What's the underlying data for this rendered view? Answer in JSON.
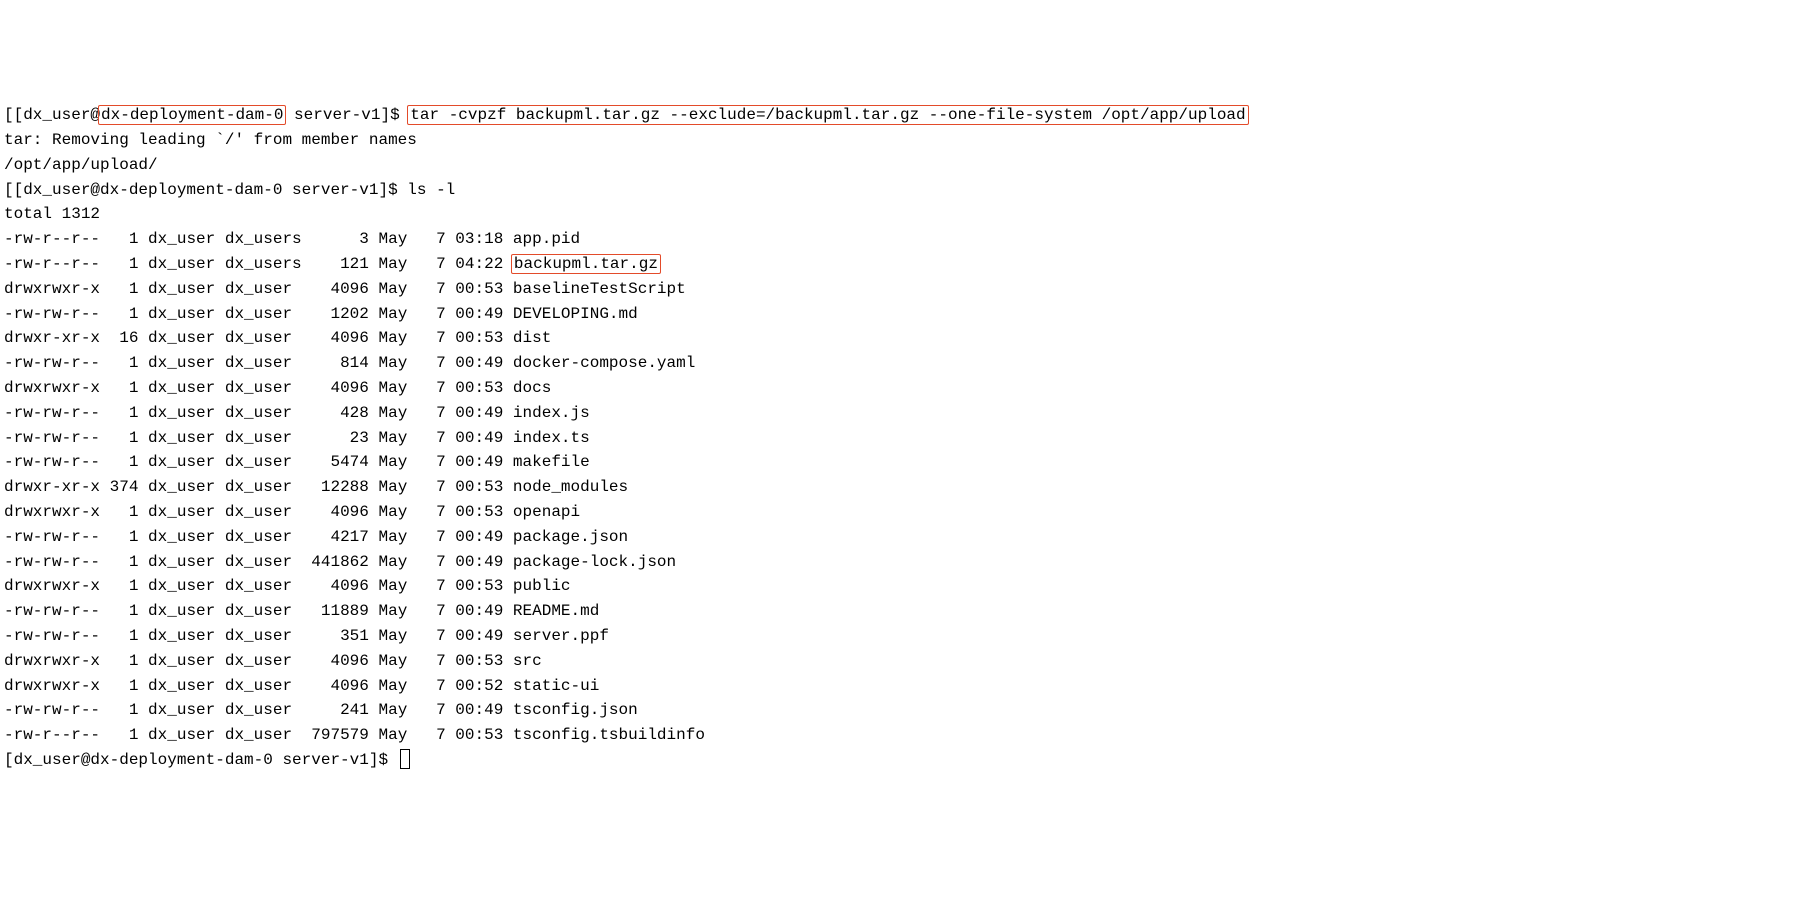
{
  "prompt1": {
    "open": "[[dx_user@",
    "host": "dx-deployment-dam-0",
    "close": " server-v1]$ ",
    "cmd": "tar -cvpzf backupml.tar.gz --exclude=/backupml.tar.gz --one-file-system /opt/app/upload"
  },
  "tar_out": {
    "l1": "tar: Removing leading `/' from member names",
    "l2": "/opt/app/upload/"
  },
  "prompt2": {
    "text": "[[dx_user@dx-deployment-dam-0 server-v1]$ ",
    "cmd": "ls -l"
  },
  "total": "total 1312",
  "rows": [
    {
      "perm": "-rw-r--r--",
      "links": "  1",
      "user": "dx_user",
      "group": "dx_users",
      "size": "     3",
      "month": "May",
      "day": "  7",
      "time": "03:18",
      "name": "app.pid",
      "hl": false
    },
    {
      "perm": "-rw-r--r--",
      "links": "  1",
      "user": "dx_user",
      "group": "dx_users",
      "size": "   121",
      "month": "May",
      "day": "  7",
      "time": "04:22",
      "name": "backupml.tar.gz",
      "hl": true
    },
    {
      "perm": "drwxrwxr-x",
      "links": "  1",
      "user": "dx_user",
      "group": "dx_user ",
      "size": "  4096",
      "month": "May",
      "day": "  7",
      "time": "00:53",
      "name": "baselineTestScript",
      "hl": false
    },
    {
      "perm": "-rw-rw-r--",
      "links": "  1",
      "user": "dx_user",
      "group": "dx_user ",
      "size": "  1202",
      "month": "May",
      "day": "  7",
      "time": "00:49",
      "name": "DEVELOPING.md",
      "hl": false
    },
    {
      "perm": "drwxr-xr-x",
      "links": " 16",
      "user": "dx_user",
      "group": "dx_user ",
      "size": "  4096",
      "month": "May",
      "day": "  7",
      "time": "00:53",
      "name": "dist",
      "hl": false
    },
    {
      "perm": "-rw-rw-r--",
      "links": "  1",
      "user": "dx_user",
      "group": "dx_user ",
      "size": "   814",
      "month": "May",
      "day": "  7",
      "time": "00:49",
      "name": "docker-compose.yaml",
      "hl": false
    },
    {
      "perm": "drwxrwxr-x",
      "links": "  1",
      "user": "dx_user",
      "group": "dx_user ",
      "size": "  4096",
      "month": "May",
      "day": "  7",
      "time": "00:53",
      "name": "docs",
      "hl": false
    },
    {
      "perm": "-rw-rw-r--",
      "links": "  1",
      "user": "dx_user",
      "group": "dx_user ",
      "size": "   428",
      "month": "May",
      "day": "  7",
      "time": "00:49",
      "name": "index.js",
      "hl": false
    },
    {
      "perm": "-rw-rw-r--",
      "links": "  1",
      "user": "dx_user",
      "group": "dx_user ",
      "size": "    23",
      "month": "May",
      "day": "  7",
      "time": "00:49",
      "name": "index.ts",
      "hl": false
    },
    {
      "perm": "-rw-rw-r--",
      "links": "  1",
      "user": "dx_user",
      "group": "dx_user ",
      "size": "  5474",
      "month": "May",
      "day": "  7",
      "time": "00:49",
      "name": "makefile",
      "hl": false
    },
    {
      "perm": "drwxr-xr-x",
      "links": "374",
      "user": "dx_user",
      "group": "dx_user ",
      "size": " 12288",
      "month": "May",
      "day": "  7",
      "time": "00:53",
      "name": "node_modules",
      "hl": false
    },
    {
      "perm": "drwxrwxr-x",
      "links": "  1",
      "user": "dx_user",
      "group": "dx_user ",
      "size": "  4096",
      "month": "May",
      "day": "  7",
      "time": "00:53",
      "name": "openapi",
      "hl": false
    },
    {
      "perm": "-rw-rw-r--",
      "links": "  1",
      "user": "dx_user",
      "group": "dx_user ",
      "size": "  4217",
      "month": "May",
      "day": "  7",
      "time": "00:49",
      "name": "package.json",
      "hl": false
    },
    {
      "perm": "-rw-rw-r--",
      "links": "  1",
      "user": "dx_user",
      "group": "dx_user ",
      "size": "441862",
      "month": "May",
      "day": "  7",
      "time": "00:49",
      "name": "package-lock.json",
      "hl": false
    },
    {
      "perm": "drwxrwxr-x",
      "links": "  1",
      "user": "dx_user",
      "group": "dx_user ",
      "size": "  4096",
      "month": "May",
      "day": "  7",
      "time": "00:53",
      "name": "public",
      "hl": false
    },
    {
      "perm": "-rw-rw-r--",
      "links": "  1",
      "user": "dx_user",
      "group": "dx_user ",
      "size": " 11889",
      "month": "May",
      "day": "  7",
      "time": "00:49",
      "name": "README.md",
      "hl": false
    },
    {
      "perm": "-rw-rw-r--",
      "links": "  1",
      "user": "dx_user",
      "group": "dx_user ",
      "size": "   351",
      "month": "May",
      "day": "  7",
      "time": "00:49",
      "name": "server.ppf",
      "hl": false
    },
    {
      "perm": "drwxrwxr-x",
      "links": "  1",
      "user": "dx_user",
      "group": "dx_user ",
      "size": "  4096",
      "month": "May",
      "day": "  7",
      "time": "00:53",
      "name": "src",
      "hl": false
    },
    {
      "perm": "drwxrwxr-x",
      "links": "  1",
      "user": "dx_user",
      "group": "dx_user ",
      "size": "  4096",
      "month": "May",
      "day": "  7",
      "time": "00:52",
      "name": "static-ui",
      "hl": false
    },
    {
      "perm": "-rw-rw-r--",
      "links": "  1",
      "user": "dx_user",
      "group": "dx_user ",
      "size": "   241",
      "month": "May",
      "day": "  7",
      "time": "00:49",
      "name": "tsconfig.json",
      "hl": false
    },
    {
      "perm": "-rw-r--r--",
      "links": "  1",
      "user": "dx_user",
      "group": "dx_user ",
      "size": "797579",
      "month": "May",
      "day": "  7",
      "time": "00:53",
      "name": "tsconfig.tsbuildinfo",
      "hl": false
    }
  ],
  "prompt3": "[dx_user@dx-deployment-dam-0 server-v1]$ "
}
